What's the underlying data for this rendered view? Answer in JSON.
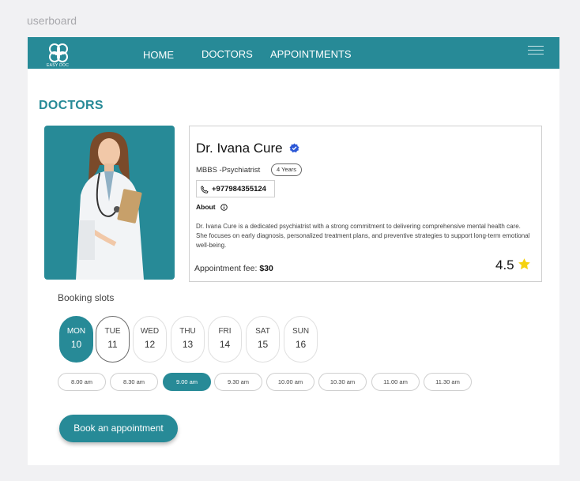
{
  "frame_label": "userboard",
  "brand": {
    "logo_text": "EASY DOC",
    "primary_color": "#278a97"
  },
  "nav": {
    "home": "HOME",
    "doctors": "DOCTORS",
    "appointments": "APPOINTMENTS"
  },
  "page": {
    "title": "DOCTORS"
  },
  "doctor": {
    "name": "Dr. Ivana Cure",
    "degree": "MBBS -Psychiatrist",
    "experience": "4 Years",
    "phone": "+977984355124",
    "about_label": "About",
    "about": "Dr. Ivana Cure is a dedicated psychiatrist with a strong commitment to delivering comprehensive mental health care. She focuses on early diagnosis, personalized treatment plans, and preventive strategies to support long-term emotional well-being.",
    "fee_label": "Appointment fee:",
    "fee_value": "$30",
    "rating": "4.5"
  },
  "booking": {
    "label": "Booking slots",
    "days": [
      {
        "name": "MON",
        "num": "10"
      },
      {
        "name": "TUE",
        "num": "11"
      },
      {
        "name": "WED",
        "num": "12"
      },
      {
        "name": "THU",
        "num": "13"
      },
      {
        "name": "FRI",
        "num": "14"
      },
      {
        "name": "SAT",
        "num": "15"
      },
      {
        "name": "SUN",
        "num": "16"
      }
    ],
    "times": [
      "8.00 am",
      "8.30 am",
      "9.00 am",
      "9.30 am",
      "10.00 am",
      "10.30 am",
      "11.00 am",
      "11.30 am"
    ],
    "selected_day": "MON",
    "selected_time": "9.00 am",
    "button": "Book an appointment"
  }
}
